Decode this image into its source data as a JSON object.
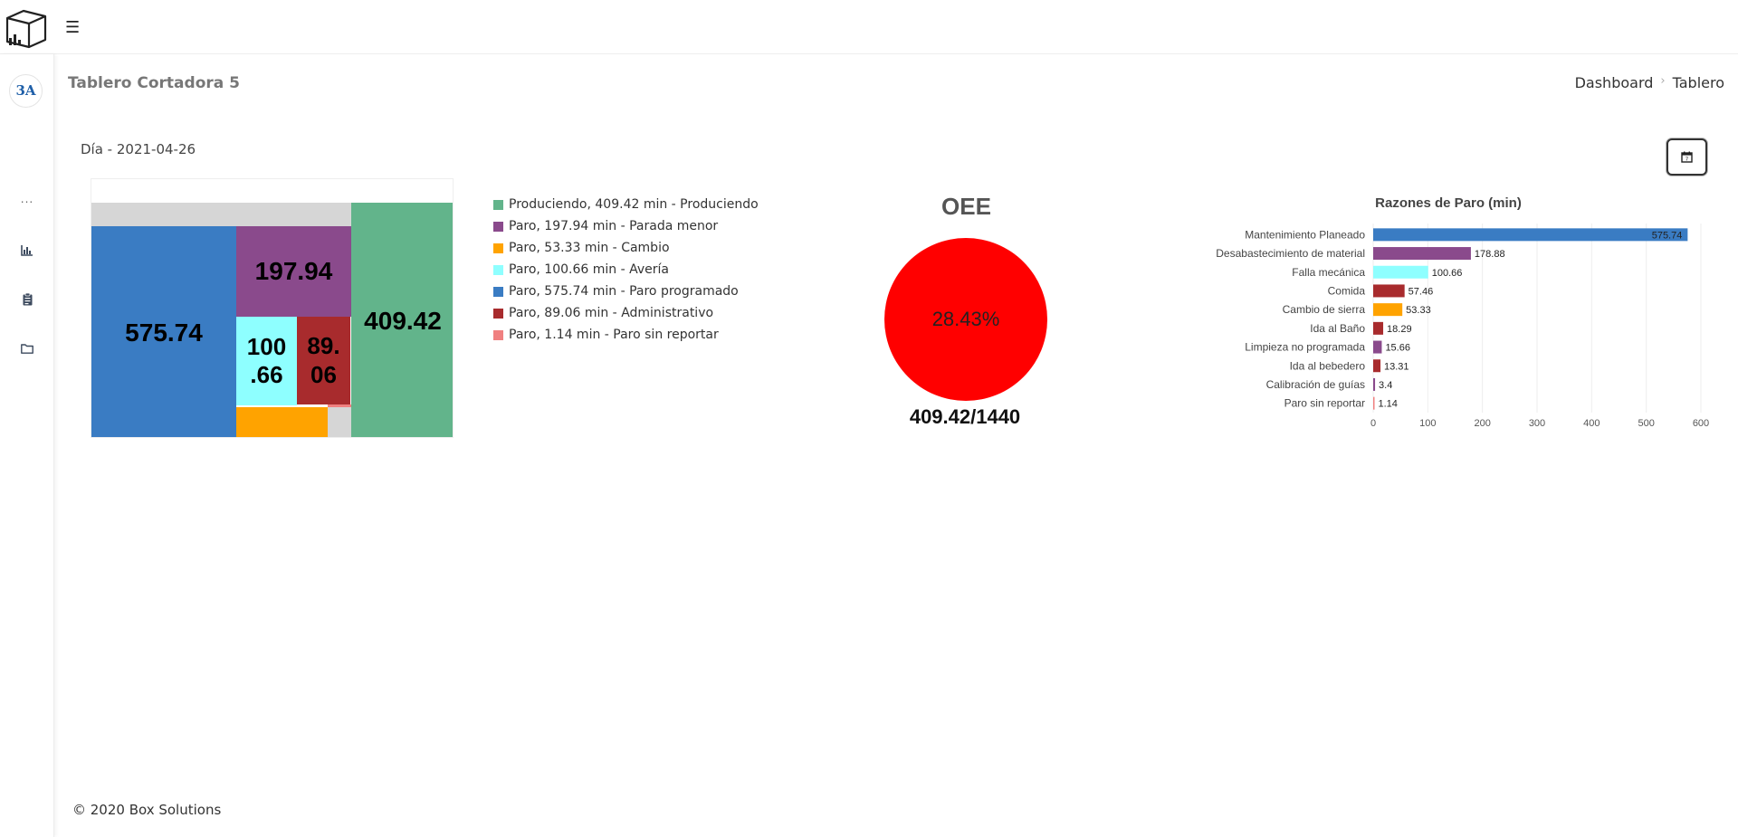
{
  "header": {
    "menu_icon": "hamburger-menu-icon",
    "logo_icon": "box-logo-icon"
  },
  "sidebar": {
    "avatar_text": "3A",
    "dots": "...",
    "items": [
      {
        "icon": "bar-chart-icon"
      },
      {
        "icon": "clipboard-icon"
      },
      {
        "icon": "folder-icon"
      }
    ]
  },
  "page": {
    "title": "Tablero Cortadora 5"
  },
  "breadcrumb": {
    "home": "Dashboard",
    "current": "Tablero"
  },
  "filter": {
    "day_label": "Día - 2021-04-26",
    "calendar_icon": "calendar-icon"
  },
  "treemap": {
    "tiles": [
      {
        "label": "575.74",
        "color": "#3a7cc3"
      },
      {
        "label": "197.94",
        "color": "#8a4a8c"
      },
      {
        "label": "100\n.66",
        "color": "#8effff"
      },
      {
        "label": "89.\n06",
        "color": "#a82b2d"
      },
      {
        "label": "409.42",
        "color": "#62b48b"
      },
      {
        "label": "",
        "color": "#ffa300"
      },
      {
        "label": "",
        "color": "#f08080"
      }
    ]
  },
  "legend": [
    {
      "text": "Produciendo, 409.42 min - Produciendo",
      "color": "#62b48b"
    },
    {
      "text": "Paro, 197.94 min - Parada menor",
      "color": "#8a4a8c"
    },
    {
      "text": "Paro, 53.33 min - Cambio",
      "color": "#ffa300"
    },
    {
      "text": "Paro, 100.66 min - Avería",
      "color": "#8effff"
    },
    {
      "text": "Paro, 575.74 min - Paro programado",
      "color": "#3a7cc3"
    },
    {
      "text": "Paro, 89.06 min - Administrativo",
      "color": "#a82b2d"
    },
    {
      "text": "Paro, 1.14 min - Paro sin reportar",
      "color": "#f08080"
    }
  ],
  "oee": {
    "title": "OEE",
    "percent": "28.43%",
    "ratio": "409.42/1440",
    "color": "#ff0000"
  },
  "chart_data": {
    "type": "bar",
    "orientation": "horizontal",
    "title": "Razones de Paro (min)",
    "categories": [
      "Mantenimiento Planeado",
      "Desabastecimiento de material",
      "Falla mecánica",
      "Comida",
      "Cambio de sierra",
      "Ida al Baño",
      "Limpieza no programada",
      "Ida al bebedero",
      "Calibración de guías",
      "Paro sin reportar"
    ],
    "values": [
      575.74,
      178.88,
      100.66,
      57.46,
      53.33,
      18.29,
      15.66,
      13.31,
      3.4,
      1.14
    ],
    "colors": [
      "#3a7cc3",
      "#8a4a8c",
      "#8effff",
      "#a82b2d",
      "#ffa300",
      "#a82b2d",
      "#8a4a8c",
      "#a82b2d",
      "#8a4a8c",
      "#f08080"
    ],
    "xticks": [
      0,
      100,
      200,
      300,
      400,
      500,
      600
    ],
    "xlim": [
      0,
      600
    ],
    "grid": true
  },
  "footer": {
    "copyright": "© 2020 Box Solutions"
  }
}
